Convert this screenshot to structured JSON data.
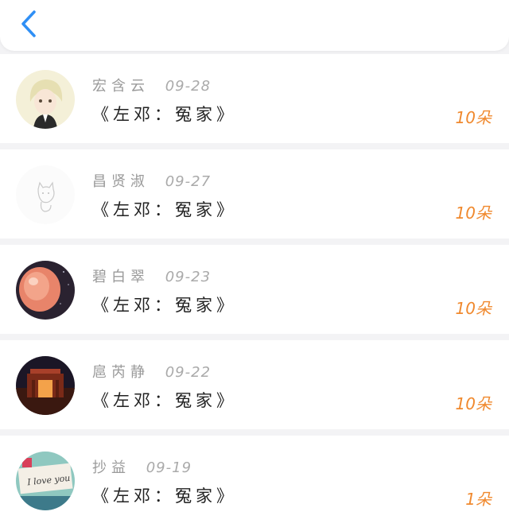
{
  "header": {
    "back_icon": "chevron-left-icon",
    "accent": "#2f8ff5"
  },
  "gifts": [
    {
      "name": "宏含云",
      "date": "09-28",
      "title": "《左邓：冤家》",
      "amount": "10朵"
    },
    {
      "name": "昌贤淑",
      "date": "09-27",
      "title": "《左邓：冤家》",
      "amount": "10朵"
    },
    {
      "name": "碧白翠",
      "date": "09-23",
      "title": "《左邓：冤家》",
      "amount": "10朵"
    },
    {
      "name": "扈芮静",
      "date": "09-22",
      "title": "《左邓：冤家》",
      "amount": "10朵"
    },
    {
      "name": "抄益",
      "date": "09-19",
      "title": "《左邓：冤家》",
      "amount": "1朵",
      "avatar_text": "I love you"
    }
  ],
  "colors": {
    "amount": "#f0892e",
    "background": "#f3f3f5"
  }
}
